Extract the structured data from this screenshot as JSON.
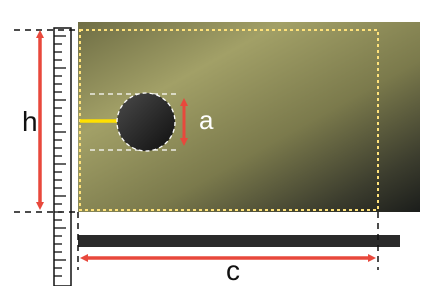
{
  "diagram": {
    "labels": {
      "height": "h",
      "hole_diameter": "a",
      "length": "c"
    },
    "colors": {
      "arrow": "#e8483c",
      "crack": "#ffe000",
      "outline": "#ffe27a",
      "plate_light": "#9b9a62",
      "plate_dark": "#1d1f1c",
      "bar": "#2a2a2a"
    }
  }
}
